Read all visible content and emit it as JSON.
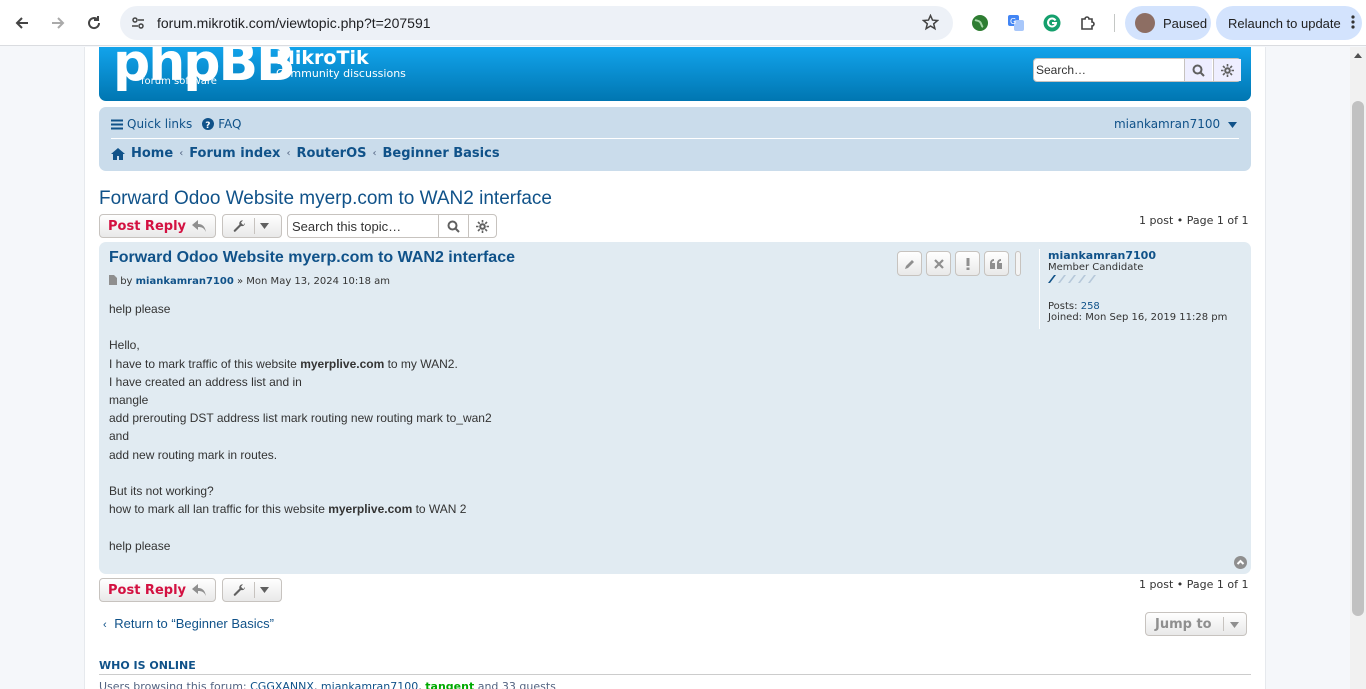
{
  "browser": {
    "url": "forum.mikrotik.com/viewtopic.php?t=207591",
    "profile_label": "Paused",
    "relaunch_label": "Relaunch to update"
  },
  "header": {
    "logo_text": "phpBB",
    "logo_sub": "forum    software",
    "site_name": "MikroTik",
    "site_description": "Community discussions",
    "search_placeholder": "Search…"
  },
  "nav": {
    "quick_links": "Quick links",
    "faq": "FAQ",
    "username": "miankamran7100",
    "breadcrumbs": [
      "Home",
      "Forum index",
      "RouterOS",
      "Beginner Basics"
    ]
  },
  "topic": {
    "title": "Forward Odoo Website myerp.com to WAN2 interface",
    "post_reply_label": "Post Reply",
    "search_topic_placeholder": "Search this topic…",
    "pagination_top": "1 post • Page 1 of 1",
    "pagination_bottom": "1 post • Page 1 of 1"
  },
  "post": {
    "title": "Forward Odoo Website myerp.com to WAN2 interface",
    "by": "by",
    "author": "miankamran7100",
    "date": "» Mon May 13, 2024 10:18 am",
    "body": [
      {
        "text": "help please"
      },
      {
        "text": ""
      },
      {
        "text": "Hello,"
      },
      {
        "pre": "I have to mark traffic of this website ",
        "bold": "myerplive.com",
        "post": " to my WAN2."
      },
      {
        "text": "I have created an address list and in"
      },
      {
        "text": "mangle"
      },
      {
        "text": "add prerouting DST address list mark routing new routing mark to_wan2"
      },
      {
        "text": "and"
      },
      {
        "text": "add new routing mark in routes."
      },
      {
        "text": ""
      },
      {
        "text": "But its not working?"
      },
      {
        "pre": "how to mark all lan traffic for this website ",
        "bold": "myerplive.com",
        "post": " to WAN 2"
      },
      {
        "text": ""
      },
      {
        "text": "help please"
      }
    ],
    "profile": {
      "username": "miankamran7100",
      "rank": "Member Candidate",
      "posts_label": "Posts:",
      "posts_value": "258",
      "joined_label": "Joined:",
      "joined_value": "Mon Sep 16, 2019 11:28 pm"
    }
  },
  "footer": {
    "return_link": "Return to “Beginner Basics”",
    "jump_to": "Jump to",
    "who_is_online_title": "WHO IS ONLINE",
    "online_prefix": "Users browsing this forum: ",
    "online_users": [
      "CGGXANNX",
      "miankamran7100",
      "tangent"
    ],
    "online_suffix": " and 33 guests"
  },
  "colors": {
    "header_blue": "#0076b1",
    "nav_bg": "#cadceb",
    "post_bg": "#e1ebf2",
    "reply_red": "#d31141",
    "link_blue": "#105289"
  }
}
